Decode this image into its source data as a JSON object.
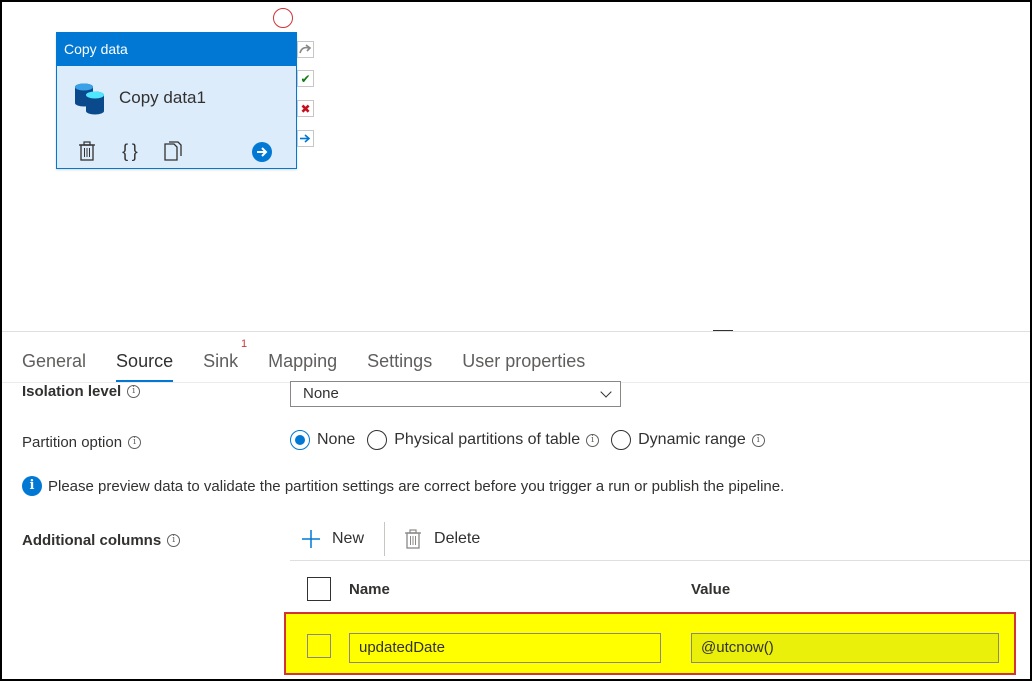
{
  "activity": {
    "type_label": "Copy data",
    "name": "Copy data1",
    "tools": [
      "delete-icon",
      "code-icon",
      "clone-icon",
      "go-arrow-icon"
    ]
  },
  "tabs": [
    {
      "label": "General"
    },
    {
      "label": "Source",
      "active": true
    },
    {
      "label": "Sink",
      "badge": "1"
    },
    {
      "label": "Mapping"
    },
    {
      "label": "Settings"
    },
    {
      "label": "User properties"
    }
  ],
  "isolation": {
    "label": "Isolation level",
    "value": "None"
  },
  "partition": {
    "label": "Partition option",
    "options": [
      {
        "label": "None",
        "selected": true
      },
      {
        "label": "Physical partitions of table",
        "selected": false
      },
      {
        "label": "Dynamic range",
        "selected": false
      }
    ]
  },
  "info_message": "Please preview data to validate the partition settings are correct before you trigger a run or publish the pipeline.",
  "additional_columns": {
    "label": "Additional columns",
    "new_label": "New",
    "delete_label": "Delete",
    "headers": {
      "name": "Name",
      "value": "Value"
    },
    "rows": [
      {
        "name": "updatedDate",
        "value": "@utcnow()"
      }
    ]
  },
  "colors": {
    "accent": "#0078d4",
    "highlight": "#ffff00",
    "highlight_border": "#d13438",
    "activity_bg": "#dcecfb"
  }
}
